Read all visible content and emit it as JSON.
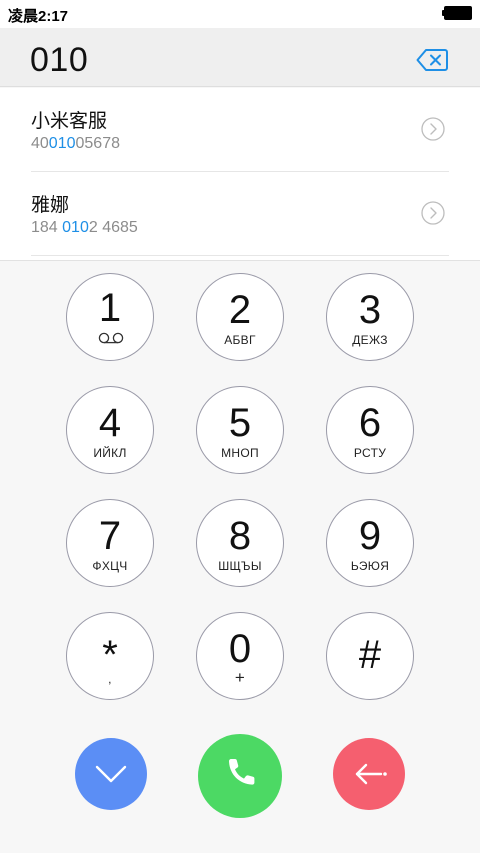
{
  "status_bar": {
    "time": "凌晨2:17"
  },
  "dialer": {
    "dialed_number": "010"
  },
  "contacts": [
    {
      "name": "小米客服",
      "number_before": "40",
      "number_match": "010",
      "number_after": "05678"
    },
    {
      "name": "雅娜",
      "number_before": "184 ",
      "number_match": "010",
      "number_after": "2 4685"
    }
  ],
  "keypad": {
    "keys": [
      {
        "digit": "1",
        "letters": ""
      },
      {
        "digit": "2",
        "letters": "АБВГ"
      },
      {
        "digit": "3",
        "letters": "ДЕЖЗ"
      },
      {
        "digit": "4",
        "letters": "ИЙКЛ"
      },
      {
        "digit": "5",
        "letters": "МНОП"
      },
      {
        "digit": "6",
        "letters": "РСТУ"
      },
      {
        "digit": "7",
        "letters": "ФХЦЧ"
      },
      {
        "digit": "8",
        "letters": "ШЩЪЫ"
      },
      {
        "digit": "9",
        "letters": "ЬЭЮЯ"
      },
      {
        "digit": "*",
        "letters": ","
      },
      {
        "digit": "0",
        "letters": "+"
      },
      {
        "digit": "#",
        "letters": ""
      }
    ]
  },
  "colors": {
    "accent_blue": "#1e8fe6",
    "collapse_button": "#5b8ef5",
    "call_button": "#4cd964",
    "delete_button": "#f55f6f"
  },
  "icons": {
    "backspace": "backspace-icon",
    "detail": "chevron-circle-icon",
    "voicemail": "voicemail-icon",
    "collapse": "chevron-down-icon",
    "call": "phone-icon",
    "delete": "backspace-arrow-icon"
  }
}
